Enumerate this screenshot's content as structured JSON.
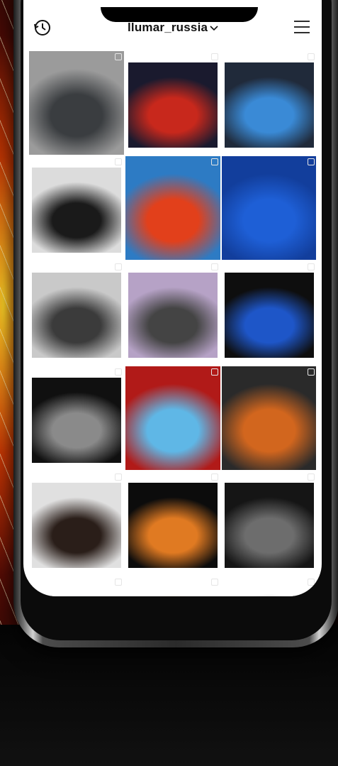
{
  "app": {
    "username": "llumar_russia"
  },
  "topbar": {
    "left_icon": "history-icon",
    "right_icon": "menu-icon",
    "dropdown_icon": "chevron-down-icon"
  },
  "grid": {
    "tiles": [
      {
        "name": "post-grey-suv-showroom",
        "colors": [
          "#9b9b9b",
          "#3a3d40"
        ]
      },
      {
        "name": "post-red-car-rear-light",
        "colors": [
          "#1a1a2e",
          "#c8281c"
        ]
      },
      {
        "name": "post-blue-car-polishing",
        "colors": [
          "#202a3a",
          "#3a8ad6"
        ]
      },
      {
        "name": "post-black-g-class",
        "colors": [
          "#dcdcdc",
          "#1a1a1a"
        ]
      },
      {
        "name": "post-film-boxes",
        "colors": [
          "#2d7bc4",
          "#e2401b"
        ]
      },
      {
        "name": "post-blue-mini-taillight",
        "colors": [
          "#123e9c",
          "#1e5fd6"
        ]
      },
      {
        "name": "post-grey-car-studio",
        "colors": [
          "#c9c9c9",
          "#3b3b3b"
        ]
      },
      {
        "name": "post-film-application",
        "colors": [
          "#b6a2c6",
          "#444"
        ]
      },
      {
        "name": "post-blue-mini-tunnel",
        "colors": [
          "#0e0e0e",
          "#1e56c8"
        ]
      },
      {
        "name": "post-g-class-headlight",
        "colors": [
          "#101010",
          "#8a8a8a"
        ]
      },
      {
        "name": "post-blue-cloth-red-car",
        "colors": [
          "#b11a18",
          "#5fb7e6"
        ]
      },
      {
        "name": "post-orange-audi-q3",
        "colors": [
          "#2a2a2a",
          "#d2661e"
        ]
      },
      {
        "name": "post-range-rover",
        "colors": [
          "#e0e0e0",
          "#2a1e19"
        ]
      },
      {
        "name": "post-orange-cars-tunnel",
        "colors": [
          "#0c0c0c",
          "#e07a22"
        ]
      },
      {
        "name": "post-g-class-light-tunnel",
        "colors": [
          "#151515",
          "#6d6d6d"
        ]
      },
      {
        "name": "post-partial-1",
        "colors": [
          "#ffffff",
          "#cfe9f4"
        ]
      },
      {
        "name": "post-partial-2",
        "colors": [
          "#ffffff",
          "#f2a53a"
        ]
      },
      {
        "name": "post-partial-3",
        "colors": [
          "#ffffff",
          "#1e1e1e"
        ]
      }
    ]
  },
  "navbar": {
    "items": [
      {
        "name": "home-icon"
      },
      {
        "name": "search-icon"
      },
      {
        "name": "add-post-icon"
      },
      {
        "name": "heart-icon"
      },
      {
        "name": "profile-avatar"
      }
    ]
  }
}
